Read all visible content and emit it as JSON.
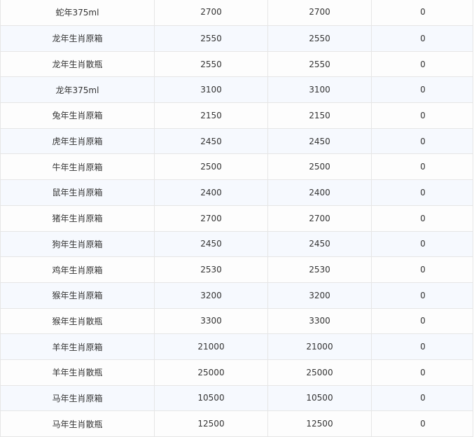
{
  "rows": [
    {
      "name": "蛇年375ml",
      "price_a": "2700",
      "price_b": "2700",
      "diff": "0"
    },
    {
      "name": "龙年生肖原箱",
      "price_a": "2550",
      "price_b": "2550",
      "diff": "0"
    },
    {
      "name": "龙年生肖散瓶",
      "price_a": "2550",
      "price_b": "2550",
      "diff": "0"
    },
    {
      "name": "龙年375ml",
      "price_a": "3100",
      "price_b": "3100",
      "diff": "0"
    },
    {
      "name": "兔年生肖原箱",
      "price_a": "2150",
      "price_b": "2150",
      "diff": "0"
    },
    {
      "name": "虎年生肖原箱",
      "price_a": "2450",
      "price_b": "2450",
      "diff": "0"
    },
    {
      "name": "牛年生肖原箱",
      "price_a": "2500",
      "price_b": "2500",
      "diff": "0"
    },
    {
      "name": "鼠年生肖原箱",
      "price_a": "2400",
      "price_b": "2400",
      "diff": "0"
    },
    {
      "name": "猪年生肖原箱",
      "price_a": "2700",
      "price_b": "2700",
      "diff": "0"
    },
    {
      "name": "狗年生肖原箱",
      "price_a": "2450",
      "price_b": "2450",
      "diff": "0"
    },
    {
      "name": "鸡年生肖原箱",
      "price_a": "2530",
      "price_b": "2530",
      "diff": "0"
    },
    {
      "name": "猴年生肖原箱",
      "price_a": "3200",
      "price_b": "3200",
      "diff": "0"
    },
    {
      "name": "猴年生肖散瓶",
      "price_a": "3300",
      "price_b": "3300",
      "diff": "0"
    },
    {
      "name": "羊年生肖原箱",
      "price_a": "21000",
      "price_b": "21000",
      "diff": "0"
    },
    {
      "name": "羊年生肖散瓶",
      "price_a": "25000",
      "price_b": "25000",
      "diff": "0"
    },
    {
      "name": "马年生肖原箱",
      "price_a": "10500",
      "price_b": "10500",
      "diff": "0"
    },
    {
      "name": "马年生肖散瓶",
      "price_a": "12500",
      "price_b": "12500",
      "diff": "0"
    }
  ]
}
